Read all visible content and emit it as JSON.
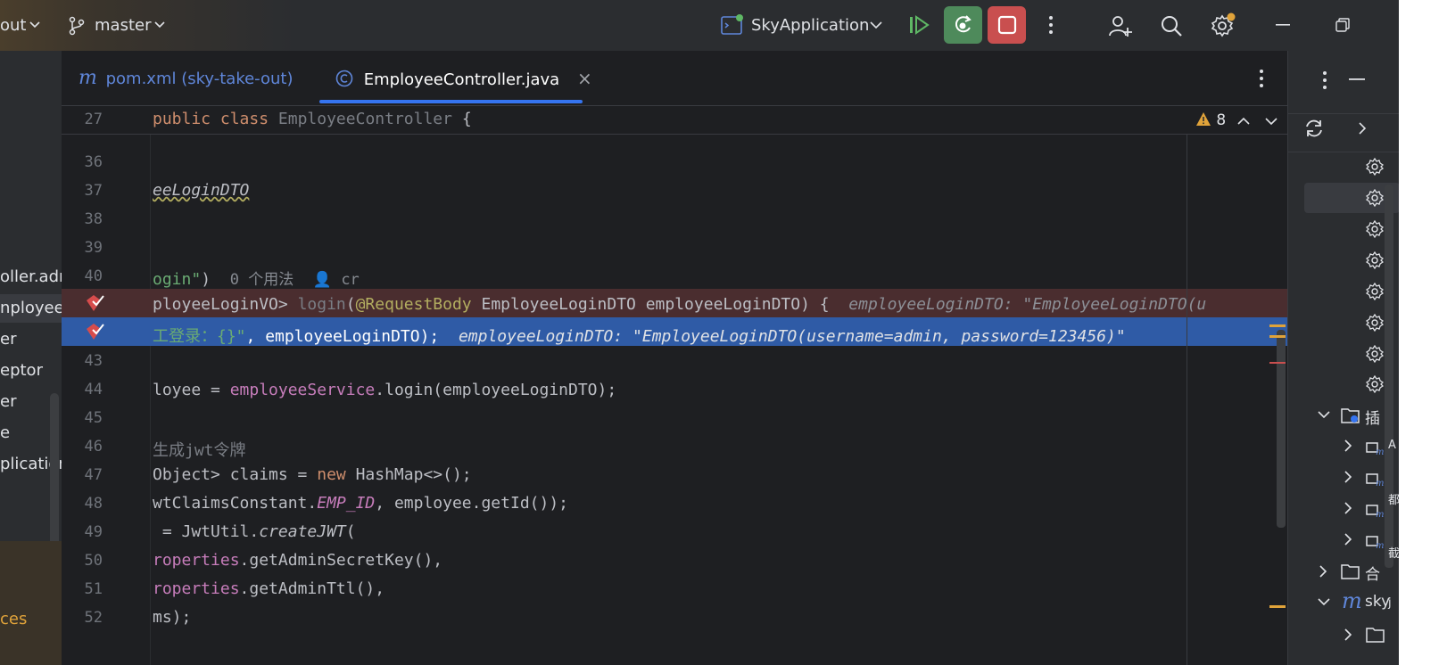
{
  "titlebar": {
    "project_fragment": "out",
    "branch": "master",
    "run_config": "SkyApplication"
  },
  "project_panel": {
    "items": [
      "oller.adm",
      "nployeeC",
      "er",
      "eptor",
      "er",
      "e",
      "plication"
    ],
    "bottom_text": "ces"
  },
  "tabs": [
    {
      "label": "pom.xml (sky-take-out)",
      "icon": "maven-m-icon"
    },
    {
      "label": "EmployeeController.java",
      "icon": "class-c-icon"
    }
  ],
  "editor": {
    "sticky": {
      "line": "27",
      "kw1": "public",
      "kw2": "class",
      "name": "EmployeeController",
      "brace": "{"
    },
    "warnings": "8",
    "lines": [
      {
        "n": "36"
      },
      {
        "n": "37",
        "text": "eeLoginDTO"
      },
      {
        "n": "38"
      },
      {
        "n": "39"
      },
      {
        "n": "40",
        "str": "ogin\"",
        "rest": ")",
        "usages": "0 个用法",
        "author": "cr"
      },
      {
        "n": "",
        "a": "ployeeLoginVO> ",
        "fn": "login",
        "p": "(",
        "ann": "@RequestBody",
        "b": " EmployeeLoginDTO employeeLoginDTO) {",
        "inlay": "employeeLoginDTO: \"EmployeeLoginDTO(u"
      },
      {
        "n": "",
        "str": "工登录：{}\"",
        "b": ", employeeLoginDTO);",
        "inlay": "employeeLoginDTO: \"EmployeeLoginDTO(username=admin, password=123456)\""
      },
      {
        "n": "43"
      },
      {
        "n": "44",
        "a": "loyee = ",
        "fld": "employeeService",
        "b": ".login(employeeLoginDTO);"
      },
      {
        "n": "45"
      },
      {
        "n": "46",
        "comment": "生成jwt令牌"
      },
      {
        "n": "47",
        "a": "Object> claims = ",
        "kw": "new",
        "b": " HashMap<>();"
      },
      {
        "n": "48",
        "a": "wtClaimsConstant.",
        "fld": "EMP_ID",
        "b": ", employee.getId());"
      },
      {
        "n": "49",
        "a": " = JwtUtil.",
        "it": "createJWT",
        "b": "("
      },
      {
        "n": "50",
        "fld": "roperties",
        "b": ".getAdminSecretKey(),"
      },
      {
        "n": "51",
        "fld": "roperties",
        "b": ".getAdminTtl(),"
      },
      {
        "n": "52",
        "b": "ms);"
      }
    ]
  },
  "right_panel": {
    "tree": [
      {
        "label": "插",
        "expanded": true
      },
      {
        "label": "合",
        "expanded": false
      },
      {
        "label": "sky",
        "expanded": true
      }
    ],
    "edge_text": [
      "A",
      "都",
      "截",
      "j"
    ]
  }
}
